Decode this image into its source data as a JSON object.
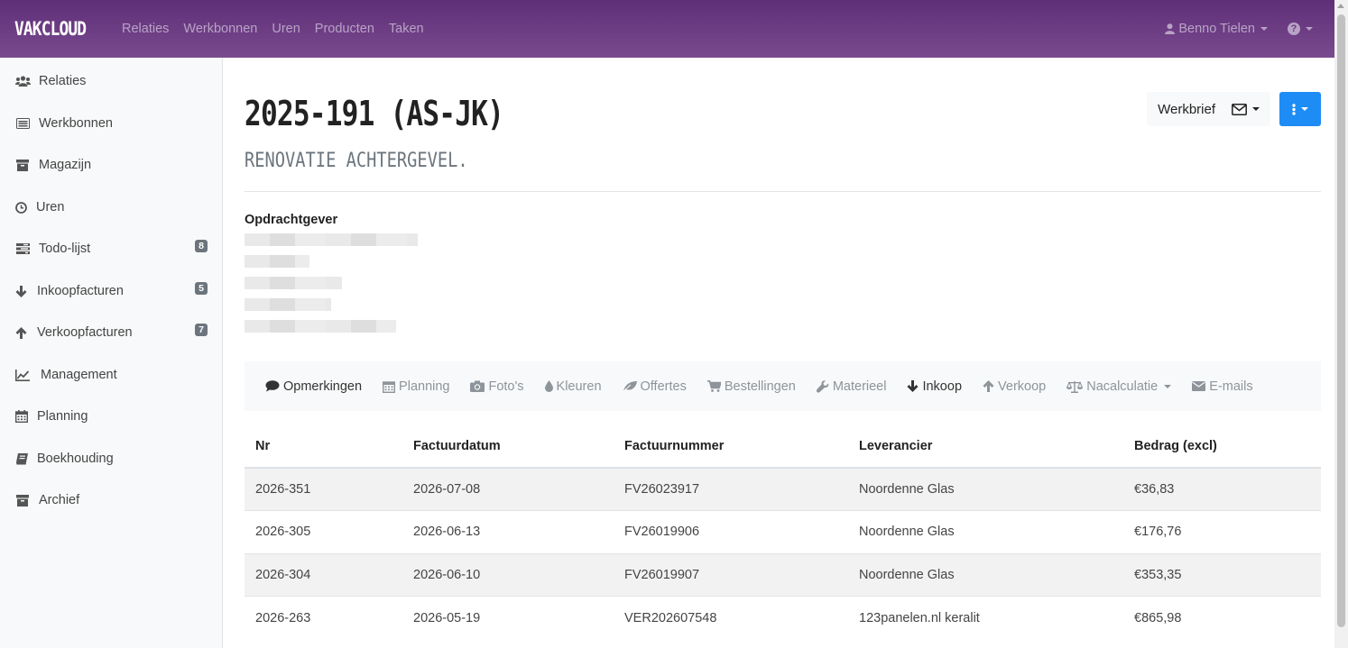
{
  "navbar": {
    "brand": "VAKCLOUD",
    "links": [
      "Relaties",
      "Werkbonnen",
      "Uren",
      "Producten",
      "Taken"
    ],
    "user": "Benno Tielen"
  },
  "sidebar": {
    "items": [
      {
        "label": "Relaties",
        "icon": "users-icon"
      },
      {
        "label": "Werkbonnen",
        "icon": "list-alt-icon"
      },
      {
        "label": "Magazijn",
        "icon": "archive-box-icon"
      },
      {
        "label": "Uren",
        "icon": "clock-icon"
      },
      {
        "label": "Todo-lijst",
        "icon": "tasks-icon",
        "badge": "8"
      },
      {
        "label": "Inkoopfacturen",
        "icon": "arrow-down-icon",
        "badge": "5"
      },
      {
        "label": "Verkoopfacturen",
        "icon": "arrow-up-icon",
        "badge": "7"
      },
      {
        "label": "Management",
        "icon": "line-chart-icon"
      },
      {
        "label": "Planning",
        "icon": "calendar-icon"
      },
      {
        "label": "Boekhouding",
        "icon": "book-icon"
      },
      {
        "label": "Archief",
        "icon": "archive-box-icon"
      }
    ]
  },
  "page": {
    "title": "2025-191 (AS-JK)",
    "subtitle": "RENOVATIE ACHTERGEVEL.",
    "werkbrief_label": "Werkbrief",
    "client_label": "Opdrachtgever"
  },
  "tabs": [
    {
      "label": "Opmerkingen",
      "icon": "comment-icon"
    },
    {
      "label": "Planning",
      "icon": "calendar-icon"
    },
    {
      "label": "Foto's",
      "icon": "camera-icon"
    },
    {
      "label": "Kleuren",
      "icon": "tint-icon"
    },
    {
      "label": "Offertes",
      "icon": "leaf-icon"
    },
    {
      "label": "Bestellingen",
      "icon": "cart-icon"
    },
    {
      "label": "Materieel",
      "icon": "wrench-icon"
    },
    {
      "label": "Inkoop",
      "icon": "arrow-down-icon"
    },
    {
      "label": "Verkoop",
      "icon": "arrow-up-icon"
    },
    {
      "label": "Nacalculatie",
      "icon": "balance-scale-icon"
    },
    {
      "label": "E-mails",
      "icon": "envelope-icon"
    }
  ],
  "table": {
    "headers": [
      "Nr",
      "Factuurdatum",
      "Factuurnummer",
      "Leverancier",
      "Bedrag (excl)"
    ],
    "rows": [
      [
        "2026-351",
        "2026-07-08",
        "FV26023917",
        "Noordenne Glas",
        "€36,83"
      ],
      [
        "2026-305",
        "2026-06-13",
        "FV26019906",
        "Noordenne Glas",
        "€176,76"
      ],
      [
        "2026-304",
        "2026-06-10",
        "FV26019907",
        "Noordenne Glas",
        "€353,35"
      ],
      [
        "2026-263",
        "2026-05-19",
        "VER202607548",
        "123panelen.nl keralit",
        "€865,98"
      ]
    ]
  },
  "colors": {
    "navbar": "#6a3b82",
    "primary": "#1e8cf5",
    "badge": "#6c757d"
  }
}
